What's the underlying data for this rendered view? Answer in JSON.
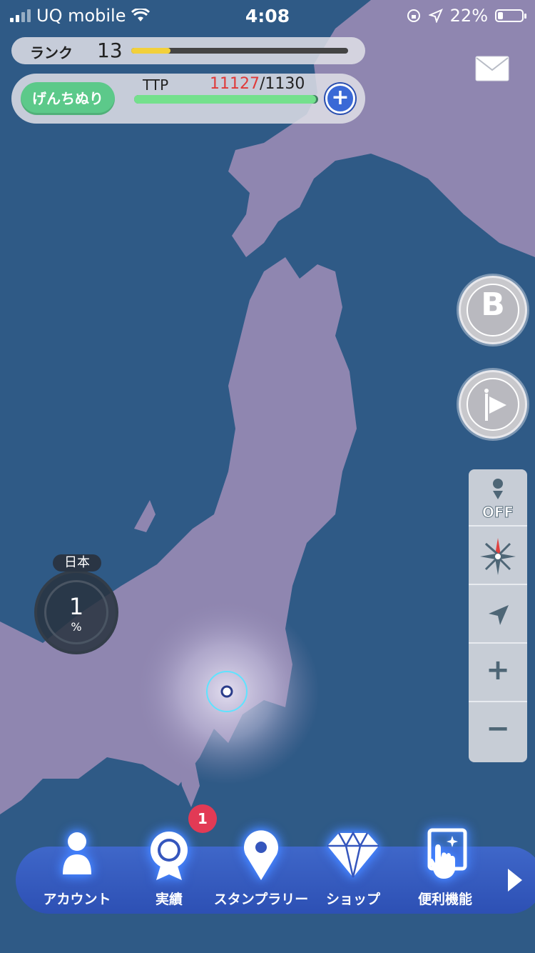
{
  "status_bar": {
    "carrier": "UQ mobile",
    "time": "4:08",
    "battery": "22%",
    "battery_level": 0.22
  },
  "rank": {
    "label": "ランク",
    "value": "13",
    "progress": 0.18
  },
  "ttp": {
    "mode_button": "げんちぬり",
    "label": "TTP",
    "current": "11127",
    "max": "/1130",
    "progress": 0.99
  },
  "map_controls": {
    "b_button": "B",
    "flag_button": "flag",
    "pin_toggle": "OFF",
    "compass": "compass",
    "locate": "locate",
    "zoom_in": "+",
    "zoom_out": "−"
  },
  "region": {
    "name": "日本",
    "percent": "1",
    "unit": "%"
  },
  "bottom_nav": {
    "items": [
      {
        "label": "アカウント",
        "icon": "person-icon"
      },
      {
        "label": "実績",
        "icon": "medal-icon"
      },
      {
        "label": "スタンプラリー",
        "icon": "map-pin-icon"
      },
      {
        "label": "ショップ",
        "icon": "diamond-icon"
      },
      {
        "label": "便利機能",
        "icon": "tools-icon"
      }
    ],
    "badge": "1"
  },
  "colors": {
    "sea": "#2f5a86",
    "land": "#8f86b0",
    "nav": "#3556bd",
    "ttp_current": "#e03a3a"
  }
}
